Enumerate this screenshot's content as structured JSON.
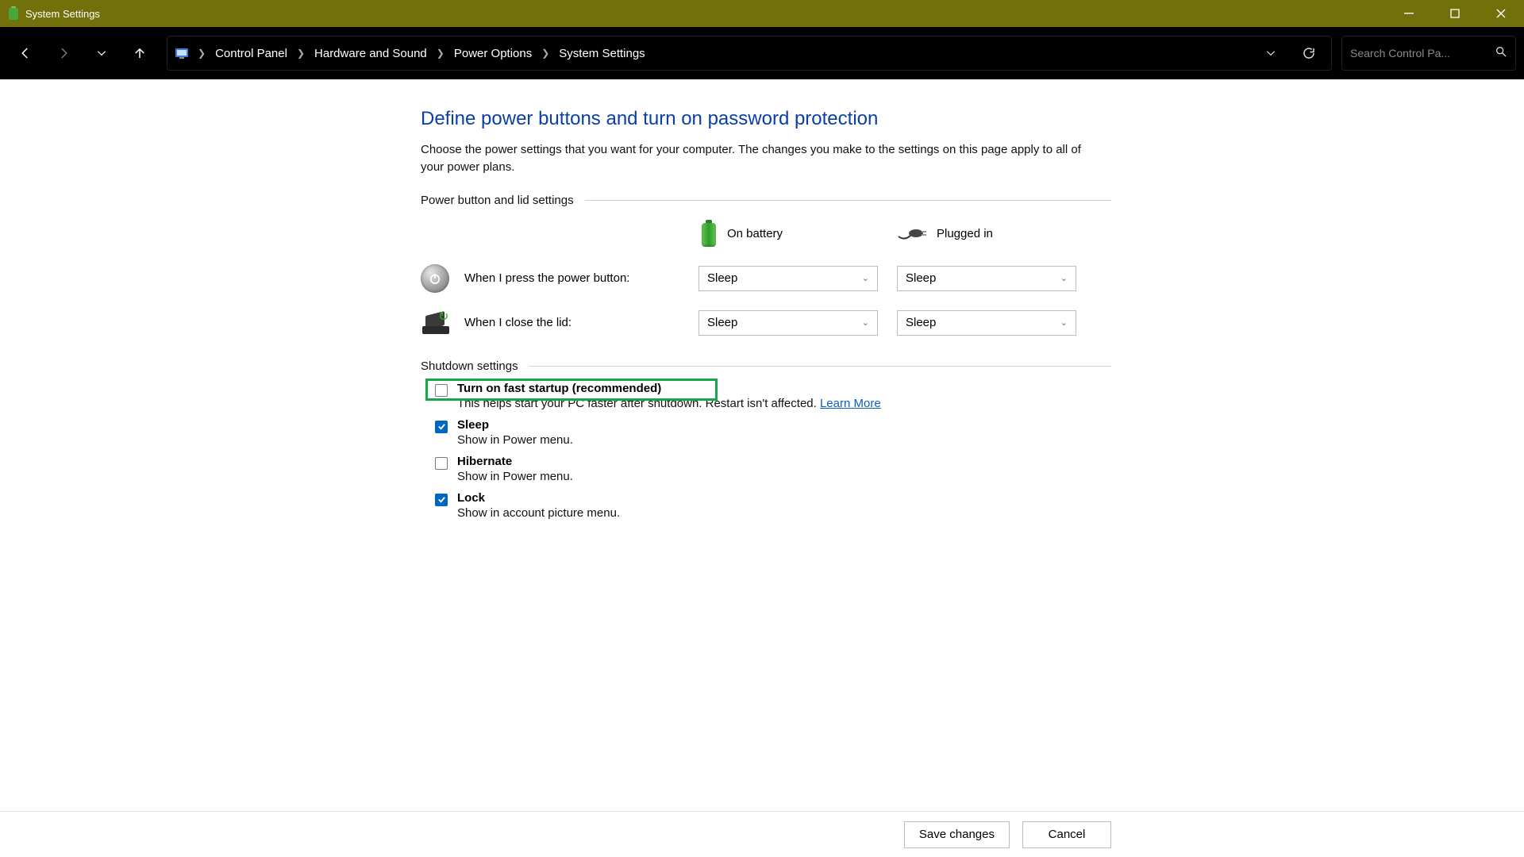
{
  "window": {
    "title": "System Settings"
  },
  "breadcrumbs": {
    "root": "Control Panel",
    "hw": "Hardware and Sound",
    "power": "Power Options",
    "sys": "System Settings"
  },
  "search": {
    "placeholder": "Search Control Pa..."
  },
  "page": {
    "title": "Define power buttons and turn on password protection",
    "desc": "Choose the power settings that you want for your computer. The changes you make to the settings on this page apply to all of your power plans."
  },
  "groups": {
    "buttons": "Power button and lid settings",
    "shutdown": "Shutdown settings"
  },
  "columns": {
    "battery": "On battery",
    "plugged": "Plugged in"
  },
  "rows": {
    "power_button": {
      "label": "When I press the power button:",
      "battery": "Sleep",
      "plugged": "Sleep"
    },
    "lid": {
      "label": "When I close the lid:",
      "battery": "Sleep",
      "plugged": "Sleep"
    }
  },
  "shutdown": {
    "fast": {
      "title": "Turn on fast startup (recommended)",
      "desc": "This helps start your PC faster after shutdown. Restart isn't affected. ",
      "learn": "Learn More",
      "checked": false
    },
    "sleep": {
      "title": "Sleep",
      "desc": "Show in Power menu.",
      "checked": true
    },
    "hibernate": {
      "title": "Hibernate",
      "desc": "Show in Power menu.",
      "checked": false
    },
    "lock": {
      "title": "Lock",
      "desc": "Show in account picture menu.",
      "checked": true
    }
  },
  "footer": {
    "save": "Save changes",
    "cancel": "Cancel"
  }
}
